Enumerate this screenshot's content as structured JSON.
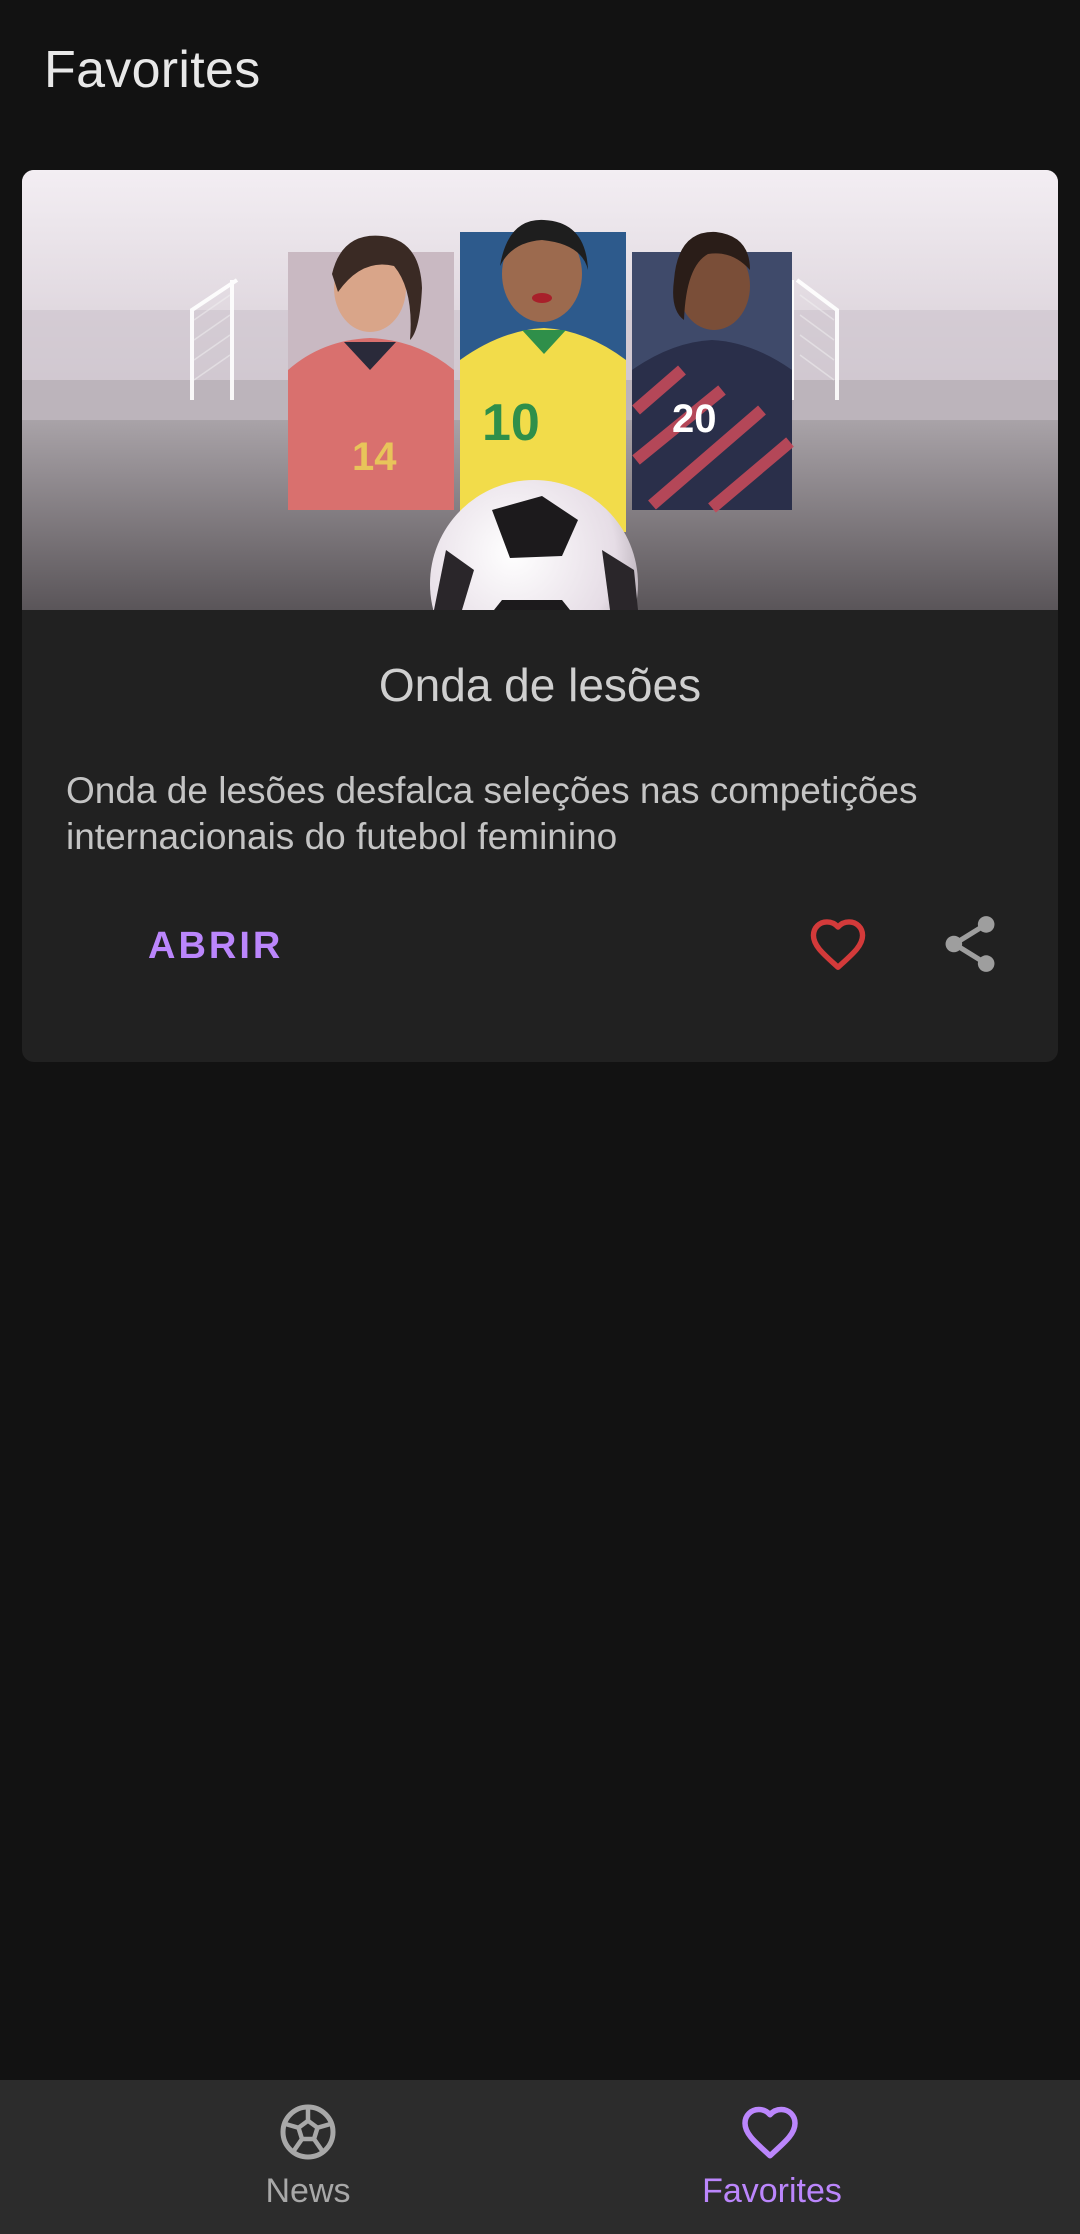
{
  "header": {
    "title": "Favorites"
  },
  "card": {
    "image_alt": "Three women's football players with a soccer ball",
    "jersey_numbers": [
      "14",
      "10",
      "20"
    ],
    "title": "Onda de lesões",
    "description": "Onda de lesões desfalca seleções nas competições internacionais do futebol feminino",
    "open_label": "ABRIR",
    "favorite_icon": "heart-icon",
    "share_icon": "share-icon"
  },
  "bottom_nav": {
    "items": [
      {
        "label": "News",
        "icon": "soccer-ball-icon",
        "selected": false
      },
      {
        "label": "Favorites",
        "icon": "heart-icon",
        "selected": true
      }
    ]
  },
  "colors": {
    "background": "#121212",
    "card": "#212121",
    "accent": "#bb86fc",
    "favorite_red": "#e53935",
    "nav_bar": "#2c2c2c"
  }
}
